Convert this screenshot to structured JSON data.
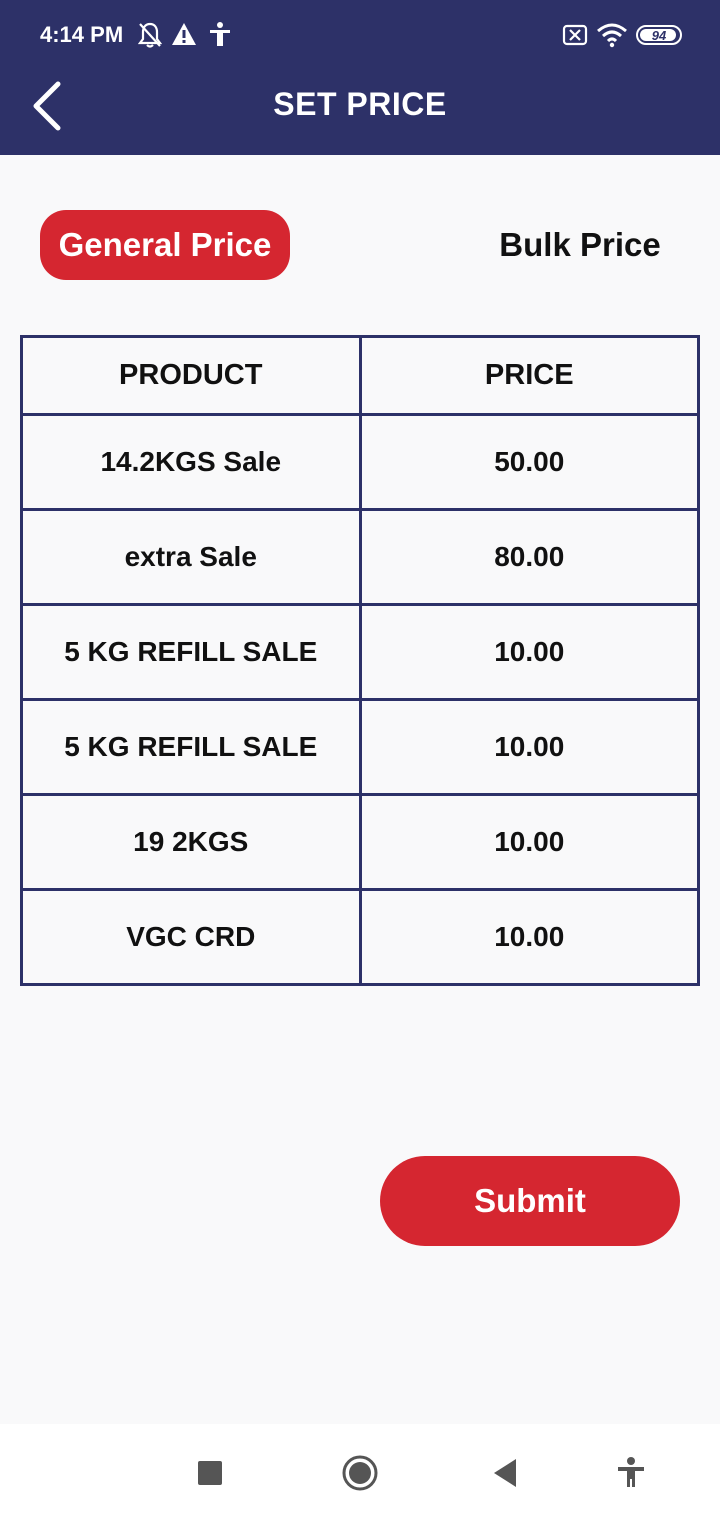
{
  "status_bar": {
    "time": "4:14 PM",
    "battery": "94",
    "icons": [
      "bell-off-icon",
      "warning-icon",
      "accessibility-icon",
      "sim-off-icon",
      "wifi-icon",
      "battery-icon"
    ]
  },
  "header": {
    "title": "SET PRICE",
    "back_icon": "chevron-left-icon"
  },
  "tabs": {
    "general_label": "General Price",
    "bulk_label": "Bulk Price",
    "active": "general"
  },
  "table": {
    "headers": [
      "PRODUCT",
      "PRICE"
    ],
    "rows": [
      {
        "product": "14.2KGS Sale",
        "price": "50.00"
      },
      {
        "product": "extra Sale",
        "price": "80.00"
      },
      {
        "product": "5 KG REFILL SALE",
        "price": "10.00"
      },
      {
        "product": "5 KG REFILL SALE",
        "price": "10.00"
      },
      {
        "product": "19 2KGS",
        "price": "10.00"
      },
      {
        "product": "VGC CRD",
        "price": "10.00"
      }
    ]
  },
  "actions": {
    "submit_label": "Submit"
  },
  "colors": {
    "primary": "#2d3168",
    "accent": "#d52630",
    "background": "#f9f9fa"
  },
  "nav_bar": {
    "icons": [
      "recents-icon",
      "home-icon",
      "back-icon",
      "accessibility-icon"
    ]
  }
}
